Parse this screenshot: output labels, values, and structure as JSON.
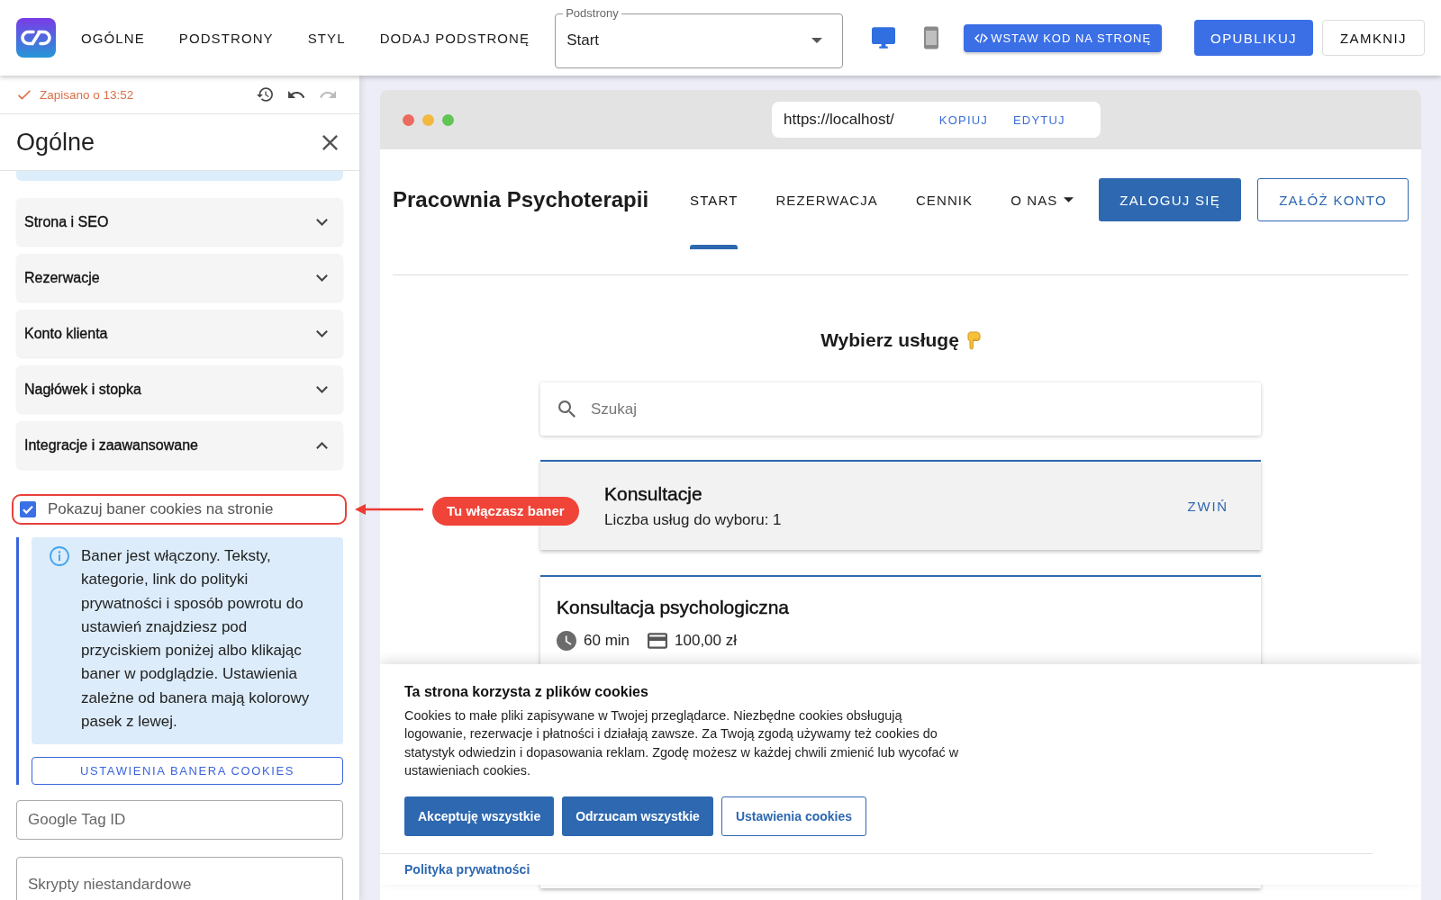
{
  "app_bar": {
    "nav": [
      "OGÓLNE",
      "PODSTRONY",
      "STYL",
      "DODAJ PODSTRONĘ"
    ],
    "page_select": {
      "label": "Podstrony",
      "value": "Start"
    },
    "devices": [
      {
        "kind": "desktop",
        "selected": true
      },
      {
        "kind": "mobile",
        "selected": false
      }
    ],
    "embed_button": "WSTAW KOD NA STRONĘ",
    "publish_button": "OPUBLIKUJ",
    "close_button": "ZAMKNIJ"
  },
  "sidebar": {
    "save_status": "Zapisano o 13:52",
    "history_actions": [
      {
        "kind": "history",
        "disabled": false
      },
      {
        "kind": "undo",
        "disabled": false
      },
      {
        "kind": "redo",
        "disabled": true
      }
    ],
    "title": "Ogólne",
    "sections": [
      {
        "label": "Strona i SEO",
        "expanded": false
      },
      {
        "label": "Rezerwacje",
        "expanded": false
      },
      {
        "label": "Konto klienta",
        "expanded": false
      },
      {
        "label": "Nagłówek i stopka",
        "expanded": false
      },
      {
        "label": "Integracje i zaawansowane",
        "expanded": true
      }
    ],
    "cookie_toggle": {
      "label": "Pokazuj baner cookies na stronie",
      "checked": true,
      "highlighted": true
    },
    "info": "Baner jest włączony. Teksty, kategorie, link do polityki prywatności i sposób powrotu do ustawień znajdziesz pod przyciskiem poniżej albo klikając baner w podglądzie. Ustawienia zależne od banera mają kolorowy pasek z lewej.",
    "banner_settings_button": "USTAWIENIA BANERA COOKIES",
    "fields": [
      {
        "placeholder": "Google Tag ID"
      },
      {
        "placeholder": "Skrypty niestandardowe"
      }
    ]
  },
  "callout": {
    "text": "Tu włączasz baner"
  },
  "preview": {
    "url": "https://localhost/",
    "url_actions": [
      "KOPIUJ",
      "EDYTUJ"
    ],
    "site": {
      "brand": "Pracownia Psychoterapii",
      "nav": [
        {
          "label": "START",
          "selected": true,
          "dropdown": false
        },
        {
          "label": "REZERWACJA",
          "selected": false,
          "dropdown": false
        },
        {
          "label": "CENNIK",
          "selected": false,
          "dropdown": false
        },
        {
          "label": "O NAS",
          "selected": false,
          "dropdown": true
        }
      ],
      "login_button": "ZALOGUJ SIĘ",
      "signup_button": "ZAŁÓŻ KONTO",
      "heading": "Wybierz usługę",
      "search": {
        "placeholder": "Szukaj"
      },
      "category": {
        "title": "Konsultacje",
        "subtitle": "Liczba usług do wyboru: 1",
        "action": "ZWIŃ"
      },
      "services": [
        {
          "title": "Konsultacja psychologiczna",
          "duration": "60 min",
          "price": "100,00 zł"
        }
      ]
    },
    "cookie_banner": {
      "title": "Ta strona korzysta z plików cookies",
      "body": "Cookies to małe pliki zapisywane w Twojej przeglądarce. Niezbędne cookies obsługują logowanie, rezerwacje i płatności i działają zawsze. Za Twoją zgodą używamy też cookies do statystyk odwiedzin i dopasowania reklam. Zgodę możesz w każdej chwili zmienić lub wycofać w ustawieniach cookies.",
      "buttons": [
        {
          "label": "Akceptuję wszystkie",
          "kind": "primary"
        },
        {
          "label": "Odrzucam wszystkie",
          "kind": "primary"
        },
        {
          "label": "Ustawienia cookies",
          "kind": "outlined"
        }
      ],
      "policy_link": "Polityka prywatności"
    }
  }
}
